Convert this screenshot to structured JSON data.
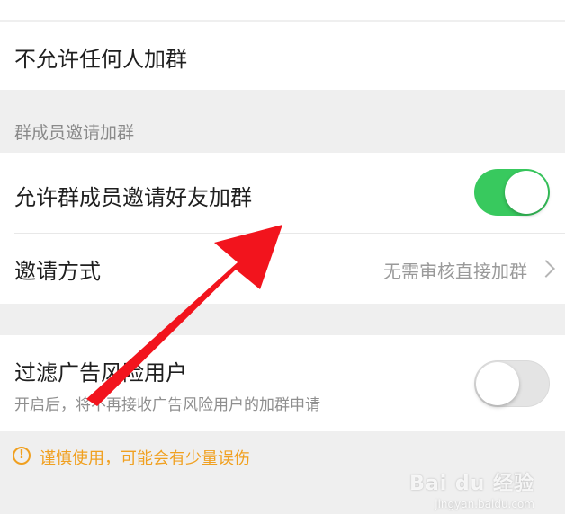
{
  "rows": {
    "no_invite": {
      "label": "不允许任何人加群"
    },
    "allow_invite": {
      "label": "允许群成员邀请好友加群",
      "toggle_on": true
    },
    "invite_method": {
      "label": "邀请方式",
      "value": "无需审核直接加群"
    },
    "filter_ads": {
      "label": "过滤广告风险用户",
      "description": "开启后，将不再接收广告风险用户的加群申请",
      "toggle_on": false
    }
  },
  "section": {
    "title": "群成员邀请加群"
  },
  "warning": {
    "text": "谨慎使用，可能会有少量误伤"
  },
  "watermark": {
    "text": "Bai du 经验",
    "url": "jingyan.baidu.com"
  },
  "colors": {
    "toggle_on": "#38c95e",
    "warning": "#f0a020",
    "arrow": "#f2141d"
  },
  "icons": {
    "chevron": "chevron-right-icon",
    "warning": "exclamation-circle-icon",
    "arrow": "red-arrow-annotation"
  }
}
